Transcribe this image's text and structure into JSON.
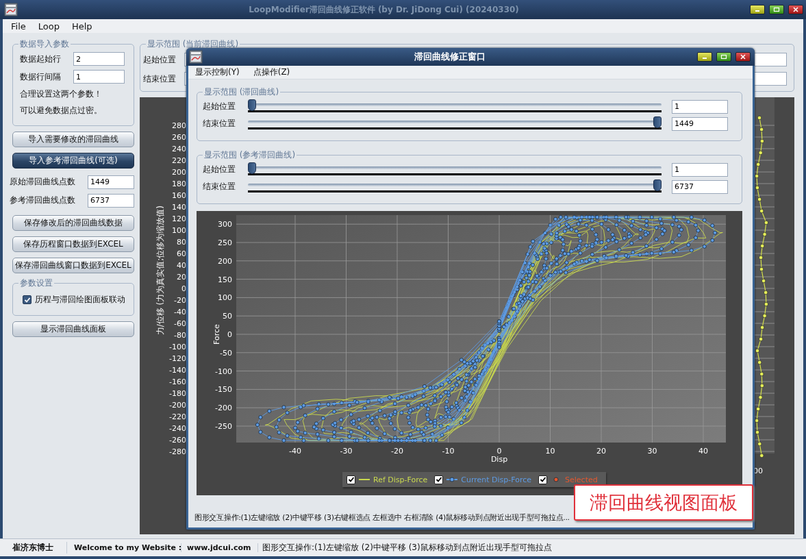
{
  "window": {
    "title": "LoopModifier滞回曲线修正软件 (by Dr. JiDong Cui) (20240330)"
  },
  "menu": [
    "File",
    "Loop",
    "Help"
  ],
  "import_params": {
    "title": "数据导入参数",
    "fields": [
      {
        "label": "数据起始行",
        "value": "2"
      },
      {
        "label": "数据行间隔",
        "value": "1"
      }
    ],
    "notes": [
      "合理设置这两个参数！",
      "可以避免数据点过密。"
    ]
  },
  "import_buttons": [
    {
      "label": "导入需要修改的滞回曲线",
      "kind": "light"
    },
    {
      "label": "导入参考滞回曲线(可选)",
      "kind": "dark"
    }
  ],
  "counts": [
    {
      "label": "原始滞回曲线点数",
      "value": "1449"
    },
    {
      "label": "参考滞回曲线点数",
      "value": "6737"
    }
  ],
  "save_buttons": [
    "保存修改后的滞回曲线数据",
    "保存历程窗口数据到EXCEL",
    "保存滞回曲线窗口数据到EXCEL"
  ],
  "settings": {
    "title": "参数设置",
    "checkbox": {
      "label": "历程与滞回绘图面板联动",
      "checked": true
    }
  },
  "show_button": "显示滞回曲线面板",
  "range_group": {
    "title": "显示范围 (当前滞回曲线)",
    "rows": [
      "起始位置",
      "结束位置"
    ]
  },
  "history_chart": {
    "ylabel": "力/位移 (力为真实值;位移为缩放值)",
    "yticks": [
      "280",
      "260",
      "240",
      "220",
      "200",
      "180",
      "160",
      "140",
      "120",
      "100",
      "80",
      "60",
      "40",
      "20",
      "0",
      "-20",
      "-40",
      "-60",
      "-80",
      "-100",
      "-120",
      "-140",
      "-160",
      "-180",
      "-200",
      "-220",
      "-240",
      "-260",
      "-280"
    ],
    "edge_tick": "00"
  },
  "dialog": {
    "title": "滞回曲线修正窗口",
    "menu": [
      "显示控制(Y)",
      "点操作(Z)"
    ],
    "groups": [
      {
        "title": "显示范围 (滞回曲线)",
        "sliders": [
          {
            "label": "起始位置",
            "level": 0,
            "value": "1"
          },
          {
            "label": "结束位置",
            "level": 1,
            "value": "1449"
          }
        ]
      },
      {
        "title": "显示范围 (参考滞回曲线)",
        "sliders": [
          {
            "label": "起始位置",
            "level": 0,
            "value": "1"
          },
          {
            "label": "结束位置",
            "level": 1,
            "value": "6737"
          }
        ]
      }
    ],
    "chart": {
      "xlabel": "Disp",
      "ylabel": "Force",
      "xticks": [
        "-40",
        "-30",
        "-20",
        "-10",
        "0",
        "10",
        "20",
        "30",
        "40"
      ],
      "yticks": [
        "300",
        "250",
        "200",
        "150",
        "100",
        "50",
        "0",
        "-50",
        "-100",
        "-150",
        "-200",
        "-250"
      ],
      "legend": [
        {
          "label": "Ref Disp-Force",
          "checked": true,
          "color": "#c9d94e",
          "kind": "line"
        },
        {
          "label": "Current Disp-Force",
          "checked": true,
          "color": "#5d9be3",
          "kind": "line-marker"
        },
        {
          "label": "Selected",
          "checked": true,
          "color": "#e4572e",
          "kind": "marker"
        }
      ]
    },
    "hint": "图形交互操作:(1)左键缩放 (2)中键平移 (3)右键框选点 左框选中 右框清除 (4)鼠标移动到点附近出现手型可拖拉点..."
  },
  "callout": "滞回曲线视图面板",
  "status_bar": [
    "崔济东博士",
    "Welcome to my Website :",
    "www.jdcui.com",
    "图形交互操作:(1)左键缩放 (2)中键平移 (3)鼠标移动到点附近出现手型可拖拉点"
  ]
}
